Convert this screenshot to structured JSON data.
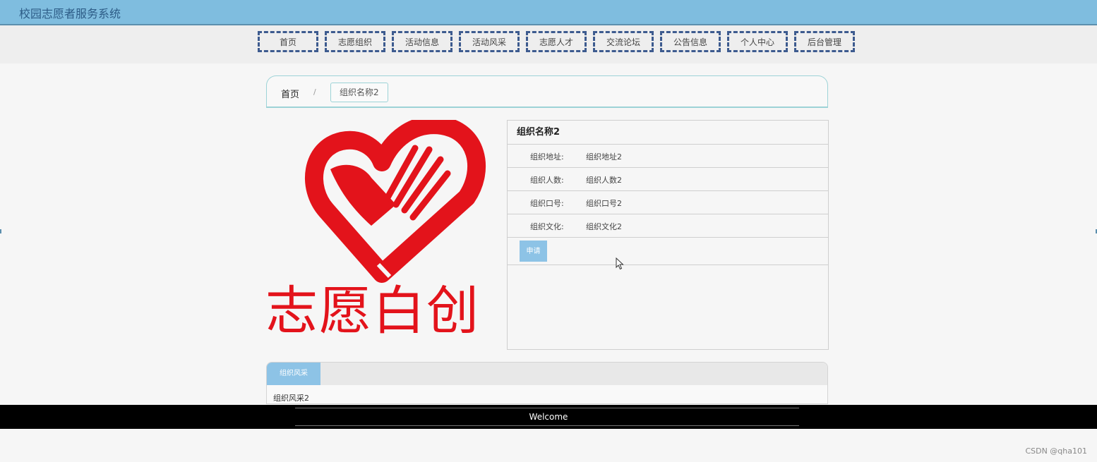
{
  "header": {
    "title": "校园志愿者服务系统"
  },
  "nav": {
    "items": [
      {
        "label": "首页"
      },
      {
        "label": "志愿组织"
      },
      {
        "label": "活动信息"
      },
      {
        "label": "活动风采"
      },
      {
        "label": "志愿人才"
      },
      {
        "label": "交流论坛"
      },
      {
        "label": "公告信息"
      },
      {
        "label": "个人中心"
      },
      {
        "label": "后台管理"
      }
    ]
  },
  "breadcrumb": {
    "home": "首页",
    "separator": "/",
    "current": "组织名称2"
  },
  "logo": {
    "text": "志愿白创",
    "color": "#e3131b"
  },
  "detail": {
    "title": "组织名称2",
    "rows": [
      {
        "label": "组织地址:",
        "value": "组织地址2"
      },
      {
        "label": "组织人数:",
        "value": "组织人数2"
      },
      {
        "label": "组织口号:",
        "value": "组织口号2"
      },
      {
        "label": "组织文化:",
        "value": "组织文化2"
      }
    ],
    "apply_label": "申请"
  },
  "tabs": {
    "active_label": "组织风采",
    "content": "组织风采2"
  },
  "footer": {
    "text": "Welcome"
  },
  "watermark": "CSDN @qha101",
  "colors": {
    "accent": "#8dc3e6",
    "header_bg": "#7fbddf",
    "nav_border": "#3d5b8f",
    "logo_red": "#e3131b"
  }
}
